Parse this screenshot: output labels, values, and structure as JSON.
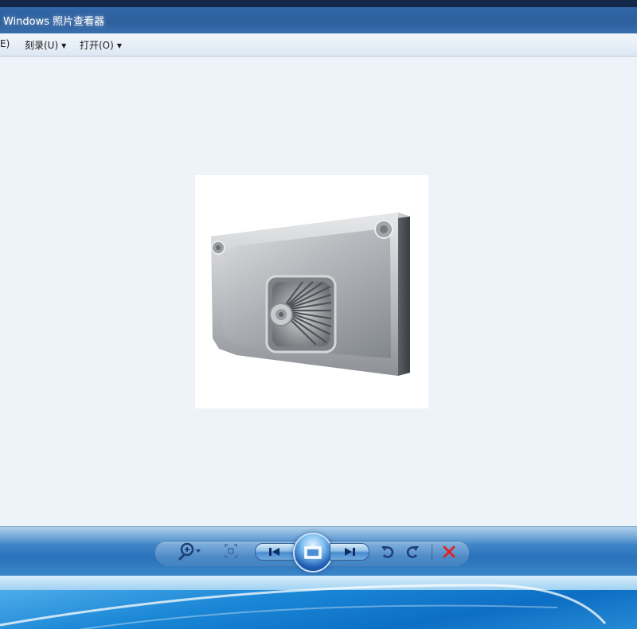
{
  "window": {
    "title": "Windows 照片查看器"
  },
  "menu": {
    "items": [
      {
        "label": "E)"
      },
      {
        "label": "刻录(U)",
        "has_dropdown": true
      },
      {
        "label": "打开(O)",
        "has_dropdown": true
      }
    ]
  },
  "viewer": {
    "background_color": "#eef2f9",
    "image_subject": "stainless steel range hood"
  },
  "controls": {
    "zoom": {
      "icon": "magnifier-plus-icon",
      "has_dropdown": true
    },
    "fit": {
      "icon": "actual-size-icon"
    },
    "previous": {
      "icon": "previous-track-icon"
    },
    "slideshow": {
      "icon": "slideshow-icon"
    },
    "next": {
      "icon": "next-track-icon"
    },
    "rotate_ccw": {
      "icon": "rotate-counterclockwise-icon"
    },
    "rotate_cw": {
      "icon": "rotate-clockwise-icon"
    },
    "delete": {
      "icon": "close-x-icon",
      "color": "#e02020"
    }
  },
  "colors": {
    "title_bar": "#2f65a6",
    "control_bar": "#2a72bb",
    "accent_blue": "#1f5fb3"
  }
}
